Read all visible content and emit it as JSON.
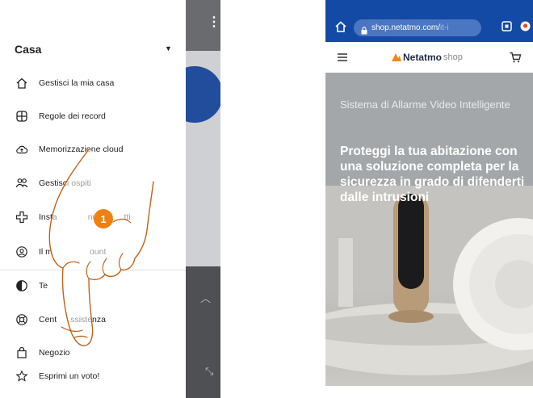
{
  "left_menu": {
    "home_name": "Casa",
    "items": [
      {
        "label": "Gestisci la mia casa",
        "icon": "house-icon"
      },
      {
        "label": "Regole dei record",
        "icon": "record-rules-icon"
      },
      {
        "label": "Memorizzazione cloud",
        "icon": "cloud-upload-icon"
      },
      {
        "label": "Gestisci ospiti",
        "icon": "guests-icon"
      },
      {
        "label": "Installa nuovi prodotti",
        "icon": "plus-icon"
      },
      {
        "label": "Il mio account",
        "icon": "account-icon"
      },
      {
        "label": "Tema",
        "icon": "theme-icon"
      },
      {
        "label": "Centro assistenza",
        "icon": "help-center-icon"
      },
      {
        "label": "Negozio",
        "icon": "shop-bag-icon"
      },
      {
        "label": "Esprimi un voto!",
        "icon": "star-icon"
      }
    ],
    "visible_labels": [
      "Gestisci la mia casa",
      "Regole dei record",
      "Memorizzazione cloud",
      "Gestisci ospiti",
      "Insta",
      "nuov",
      "tti",
      "Il m",
      "ount",
      "Te",
      "Cent",
      "ssistenza",
      "Negozio",
      "Esprimi un voto!"
    ],
    "step_number": "1",
    "accent_color": "#f07f10"
  },
  "right_browser": {
    "url_main": "shop.netatmo.com/",
    "url_dim": "it-i",
    "logo_text": "Netatmo",
    "logo_suffix": "shop",
    "hero_subtitle": "Sistema di Allarme Video Intelligente",
    "hero_headline": "Proteggi la tua abitazione con una soluzione completa per la sicurezza in grado di difenderti dalle intrusioni",
    "browser_color": "#124aa5"
  }
}
